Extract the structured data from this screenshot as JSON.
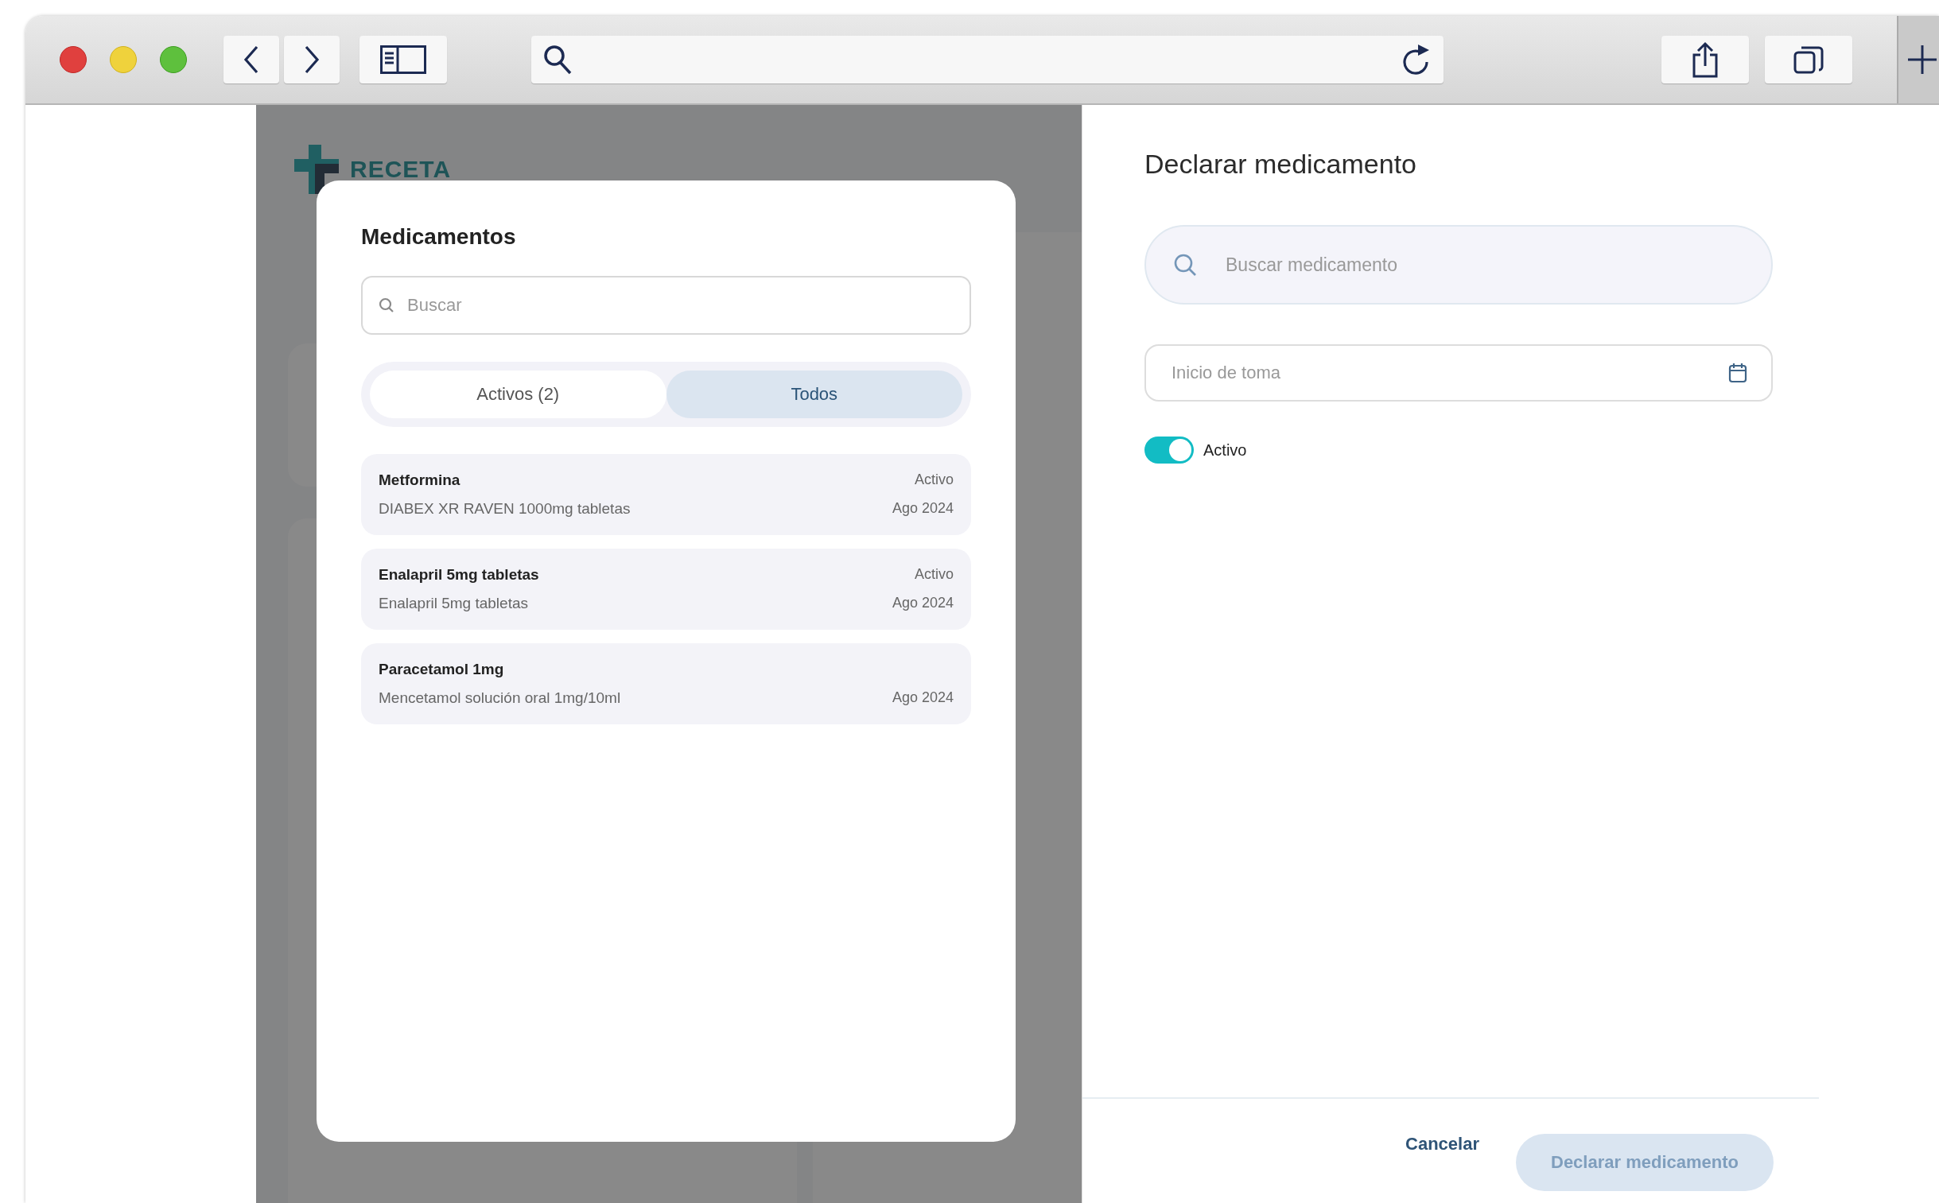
{
  "background_app": {
    "logo_line_1": "RECETA"
  },
  "modal": {
    "title": "Medicamentos",
    "search": {
      "placeholder": "Buscar"
    },
    "tabs": [
      {
        "label": "Activos (2)",
        "selected": false
      },
      {
        "label": "Todos",
        "selected": true
      }
    ],
    "items": [
      {
        "name": "Metformina",
        "description": "DIABEX XR RAVEN 1000mg tabletas",
        "status": "Activo",
        "date": "Ago 2024"
      },
      {
        "name": "Enalapril 5mg tabletas",
        "description": "Enalapril 5mg tabletas",
        "status": "Activo",
        "date": "Ago 2024"
      },
      {
        "name": "Paracetamol 1mg",
        "description": "Mencetamol solución oral 1mg/10ml",
        "date": "Ago 2024"
      }
    ]
  },
  "panel": {
    "title": "Declarar medicamento",
    "search": {
      "placeholder": "Buscar medicamento"
    },
    "date_field": {
      "placeholder": "Inicio de toma"
    },
    "toggle": {
      "label": "Activo",
      "on": true
    },
    "buttons": [
      {
        "label": "Cancelar",
        "kind": "text"
      },
      {
        "label": "Declarar medicamento",
        "kind": "primary",
        "disabled": true
      }
    ]
  }
}
